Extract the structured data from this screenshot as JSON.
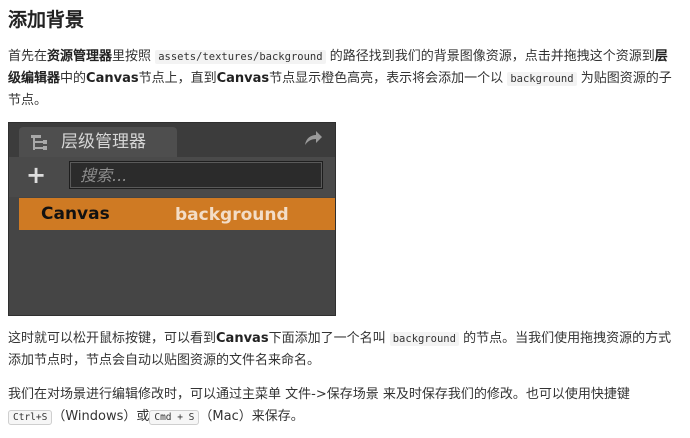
{
  "doc": {
    "title": "添加背景",
    "p1": {
      "t1": "首先在",
      "b1": "资源管理器",
      "t2": "里按照",
      "code1": "assets/textures/background",
      "t3": "的路径找到我们的背景图像资源，点击并拖拽这个资源到",
      "b2": "层级编辑器",
      "t4": "中的",
      "b3": "Canvas",
      "t5": "节点上，直到",
      "b4": "Canvas",
      "t6": "节点显示橙色高亮，表示将会添加一个以",
      "code2": "background",
      "t7": "为贴图资源的子节点。"
    },
    "p2": {
      "t1": "这时就可以松开鼠标按键，可以看到",
      "b1": "Canvas",
      "t2": "下面添加了一个名叫",
      "code1": "background",
      "t3": "的节点。当我们使用拖拽资源的方式添加节点时，节点会自动以贴图资源的文件名来命名。"
    },
    "p3": {
      "t1": "我们在对场景进行编辑修改时，可以通过主菜单",
      "t2": "文件->保存场景",
      "t3": "来及时保存我们的修改。也可以使用快捷键",
      "kbd1": "Ctrl+S",
      "t4": "（Windows）或",
      "kbd2": "Cmd + S",
      "t5": "（Mac）来保存。"
    }
  },
  "panel": {
    "tab_label": "层级管理器",
    "tab_icon": "hierarchy-tree-icon",
    "share_icon": "share-arrow-icon",
    "add_button": "+",
    "search_placeholder": "搜索...",
    "node_label": "Canvas",
    "drag_label": "background",
    "highlight_color": "#cf7a23",
    "panel_color": "#454545"
  }
}
